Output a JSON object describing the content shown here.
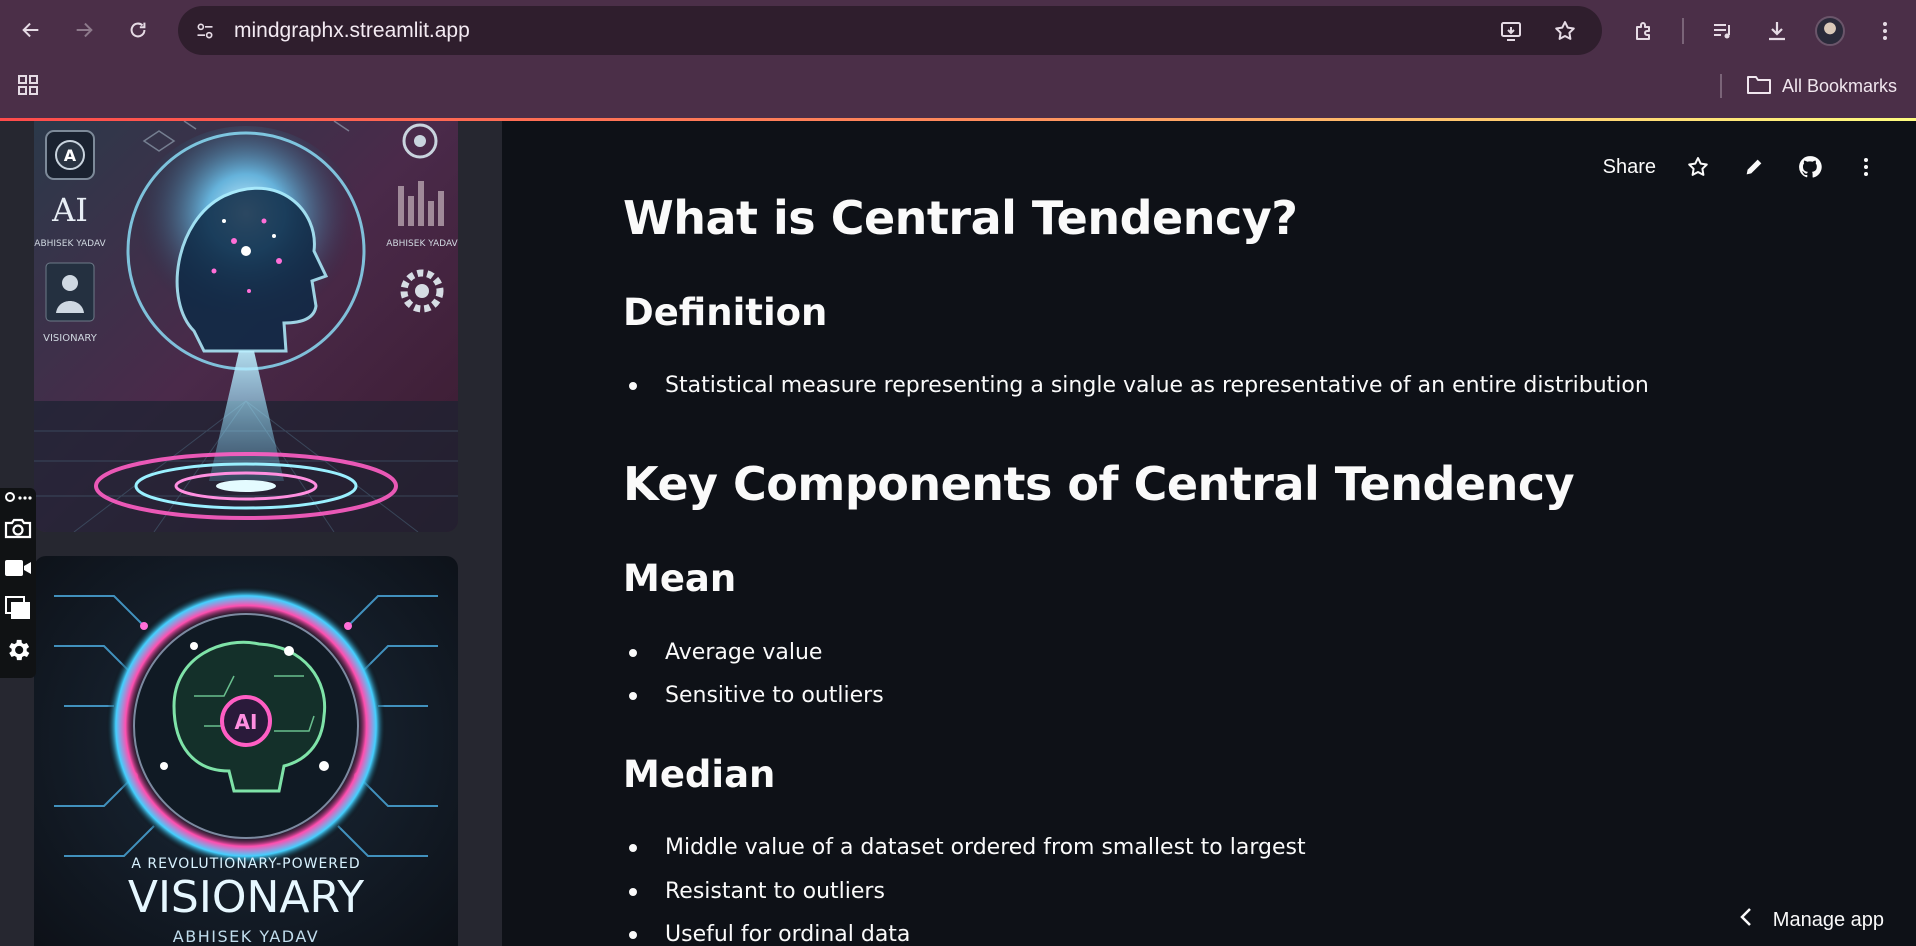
{
  "browser": {
    "url": "mindgraphx.streamlit.app",
    "bookmarks_label": "All Bookmarks"
  },
  "header": {
    "share_label": "Share"
  },
  "content": {
    "title": "What is Central Tendency?",
    "definition_heading": "Definition",
    "definition_bullets": [
      "Statistical measure representing a single value as representative of an entire distribution"
    ],
    "components_heading": "Key Components of Central Tendency",
    "mean_heading": "Mean",
    "mean_bullets": [
      "Average value",
      "Sensitive to outliers"
    ],
    "median_heading": "Median",
    "median_bullets": [
      "Middle value of a dataset ordered from smallest to largest",
      "Resistant to outliers",
      "Useful for ordinal data"
    ]
  },
  "sidebar": {
    "image1_text": {
      "badge": "A",
      "ai": "AI",
      "name_left": "ABHISEK YADAV",
      "name_right": "ABHISEK YADAV",
      "caption": "VISIONARY"
    },
    "image2_text": {
      "ai": "AI",
      "tagline": "A REVOLUTIONARY-POWERED",
      "title": "VISIONARY",
      "name": "ABHISEK YADAV"
    }
  },
  "footer": {
    "manage_label": "Manage app"
  }
}
